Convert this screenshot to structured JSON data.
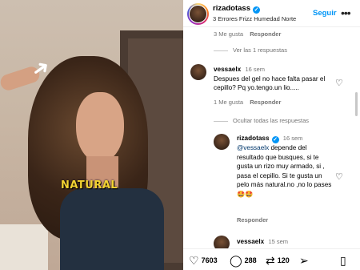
{
  "post": {
    "username": "rizadotass",
    "subtitle": "3 Errores Frizz Humedad Norte",
    "follow_label": "Seguir",
    "more_label": "•••",
    "overlay_text": "NATURAL"
  },
  "comments": {
    "top_meta": {
      "likes": "3 Me gusta",
      "reply": "Responder"
    },
    "view_replies": "Ver las 1 respuestas",
    "c1": {
      "username": "vessaelx",
      "time": "16 sem",
      "text": "Despues del gel no hace falta pasar el cepillo? Pq yo.tengo.un lio.....",
      "likes": "1 Me gusta",
      "reply": "Responder"
    },
    "hide_replies": "Ocultar todas las respuestas",
    "r1": {
      "username": "rizadotass",
      "time": "16 sem",
      "mention": "@vessaelx",
      "text": " depende del resultado que busques, si te gusta un rizo muy armado, si , pasa el cepillo. Si te gusta un pelo más natural.no ,no lo pases🤩🤩",
      "reply": "Responder"
    },
    "c2": {
      "username": "vessaelx",
      "time": "15 sem"
    }
  },
  "actions": {
    "likes": "7603",
    "comments": "288",
    "shares": "120"
  },
  "icons": {
    "verified": "verified-badge-icon",
    "heart": "heart-icon",
    "comment": "comment-icon",
    "share": "share-icon",
    "send": "send-icon",
    "bookmark": "bookmark-icon"
  }
}
